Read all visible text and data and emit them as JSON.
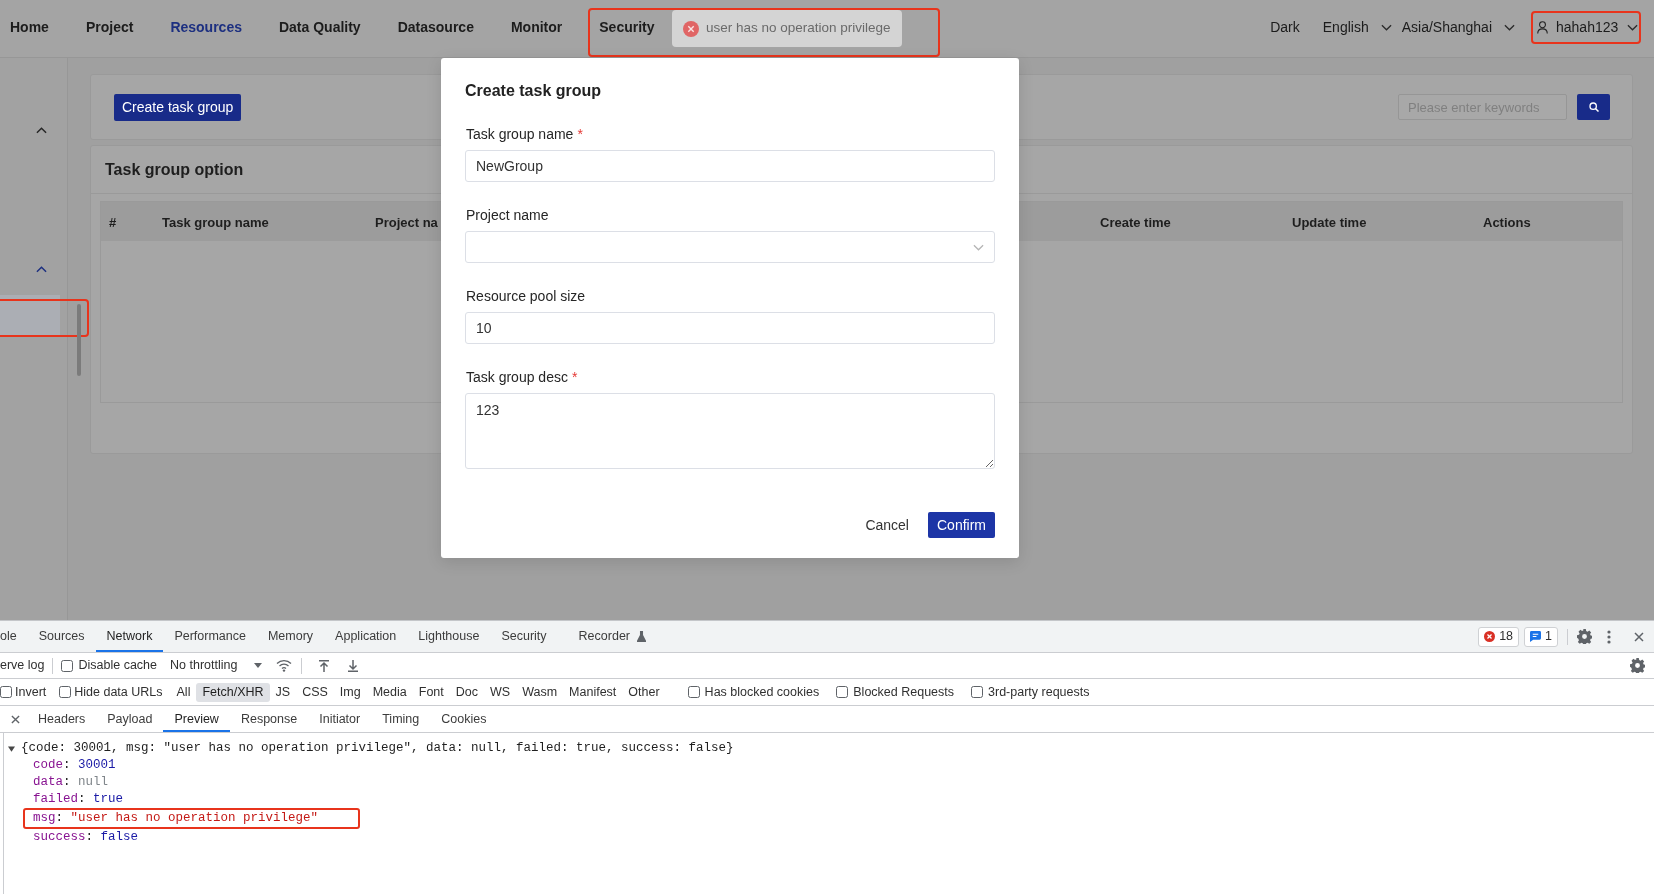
{
  "nav": {
    "items": [
      {
        "label": "Home",
        "selected": false
      },
      {
        "label": "Project",
        "selected": false
      },
      {
        "label": "Resources",
        "selected": true
      },
      {
        "label": "Data Quality",
        "selected": false
      },
      {
        "label": "Datasource",
        "selected": false
      },
      {
        "label": "Monitor",
        "selected": false
      },
      {
        "label": "Security",
        "selected": false
      }
    ],
    "theme": "Dark",
    "language": "English",
    "timezone": "Asia/Shanghai",
    "user": "hahah123"
  },
  "toast": {
    "kind": "error",
    "message": "user has no operation privilege"
  },
  "sidebar": {
    "groups": [
      {
        "expanded": true,
        "active": false
      },
      {
        "expanded": true,
        "active": true,
        "items": [
          {
            "selected": true
          }
        ]
      }
    ]
  },
  "toolbar": {
    "create_button": "Create task group",
    "search": {
      "placeholder": "Please enter keywords"
    }
  },
  "table": {
    "title": "Task group option",
    "columns": [
      "#",
      "Task group name",
      "Project na",
      "Create time",
      "Update time",
      "Actions"
    ]
  },
  "dialog": {
    "title": "Create task group",
    "fields": [
      {
        "kind": "text",
        "label": "Task group name",
        "required_mark": "*",
        "value": "NewGroup"
      },
      {
        "kind": "select",
        "label": "Project name"
      },
      {
        "kind": "text",
        "label": "Resource pool size",
        "value": "10"
      },
      {
        "kind": "textarea",
        "label": "Task group desc",
        "required_mark": "*",
        "value": "123"
      }
    ],
    "buttons": [
      {
        "label": "Cancel",
        "primary": false
      },
      {
        "label": "Confirm",
        "primary": true
      }
    ]
  },
  "devtools": {
    "panel_tabs": [
      {
        "label": "ole",
        "selected": false,
        "experimental": false
      },
      {
        "label": "Sources",
        "selected": false,
        "experimental": false
      },
      {
        "label": "Network",
        "selected": true,
        "experimental": false
      },
      {
        "label": "Performance",
        "selected": false,
        "experimental": false
      },
      {
        "label": "Memory",
        "selected": false,
        "experimental": false
      },
      {
        "label": "Application",
        "selected": false,
        "experimental": false
      },
      {
        "label": "Lighthouse",
        "selected": false,
        "experimental": false
      },
      {
        "label": "Security",
        "selected": false,
        "experimental": false
      },
      {
        "label": "Recorder",
        "selected": false,
        "experimental": true
      }
    ],
    "error_count": "18",
    "message_count": "1",
    "preserve_log_label": "erve log",
    "disable_cache": {
      "label": "Disable cache",
      "checked": false
    },
    "throttling": "No throttling",
    "filter_options": [
      {
        "label": "Invert",
        "checked": false
      },
      {
        "label": "Hide data URLs",
        "checked": false
      }
    ],
    "resource_types": [
      {
        "label": "All",
        "selected": false
      },
      {
        "label": "Fetch/XHR",
        "selected": true
      },
      {
        "label": "JS",
        "selected": false
      },
      {
        "label": "CSS",
        "selected": false
      },
      {
        "label": "Img",
        "selected": false
      },
      {
        "label": "Media",
        "selected": false
      },
      {
        "label": "Font",
        "selected": false
      },
      {
        "label": "Doc",
        "selected": false
      },
      {
        "label": "WS",
        "selected": false
      },
      {
        "label": "Wasm",
        "selected": false
      },
      {
        "label": "Manifest",
        "selected": false
      },
      {
        "label": "Other",
        "selected": false
      }
    ],
    "request_options": [
      {
        "label": "Has blocked cookies",
        "checked": false
      },
      {
        "label": "Blocked Requests",
        "checked": false
      },
      {
        "label": "3rd-party requests",
        "checked": false
      }
    ],
    "detail_tabs": [
      {
        "label": "Headers",
        "selected": false
      },
      {
        "label": "Payload",
        "selected": false
      },
      {
        "label": "Preview",
        "selected": true
      },
      {
        "label": "Response",
        "selected": false
      },
      {
        "label": "Initiator",
        "selected": false
      },
      {
        "label": "Timing",
        "selected": false
      },
      {
        "label": "Cookies",
        "selected": false
      }
    ],
    "preview": {
      "expanded": true,
      "summary": "{code: 30001, msg: \"user has no operation privilege\", data: null, failed: true, success: false}",
      "properties": [
        {
          "key": "code",
          "separator": ":",
          "value": "30001",
          "kind": "number",
          "highlighted": false
        },
        {
          "key": "data",
          "separator": ":",
          "value": "null",
          "kind": "null",
          "highlighted": false
        },
        {
          "key": "failed",
          "separator": ":",
          "value": "true",
          "kind": "boolean",
          "highlighted": false
        },
        {
          "key": "msg",
          "separator": ":",
          "value": "\"user has no operation privilege\"",
          "kind": "string",
          "highlighted": true
        },
        {
          "key": "success",
          "separator": ":",
          "value": "false",
          "kind": "boolean",
          "highlighted": false
        }
      ]
    }
  }
}
